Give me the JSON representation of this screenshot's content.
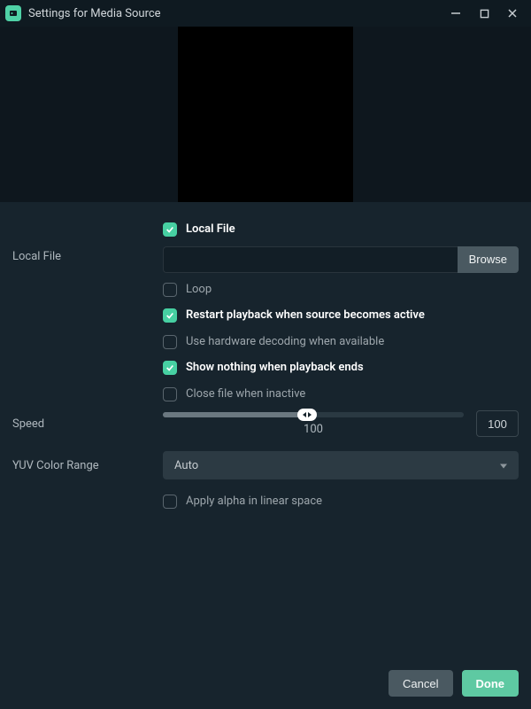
{
  "window": {
    "title": "Settings for Media Source"
  },
  "form": {
    "local_file_checkbox": "Local File",
    "local_file_label": "Local File",
    "local_file_value": "",
    "browse": "Browse",
    "loop": "Loop",
    "restart_on_active": "Restart playback when source becomes active",
    "hw_decode": "Use hardware decoding when available",
    "show_nothing": "Show nothing when playback ends",
    "close_inactive": "Close file when inactive",
    "speed_label": "Speed",
    "speed_value": "100",
    "speed_display": "100",
    "yuv_label": "YUV Color Range",
    "yuv_value": "Auto",
    "apply_alpha": "Apply alpha in linear space"
  },
  "checked": {
    "local_file": true,
    "loop": false,
    "restart_on_active": true,
    "hw_decode": false,
    "show_nothing": true,
    "close_inactive": false,
    "apply_alpha": false
  },
  "footer": {
    "cancel": "Cancel",
    "done": "Done"
  }
}
